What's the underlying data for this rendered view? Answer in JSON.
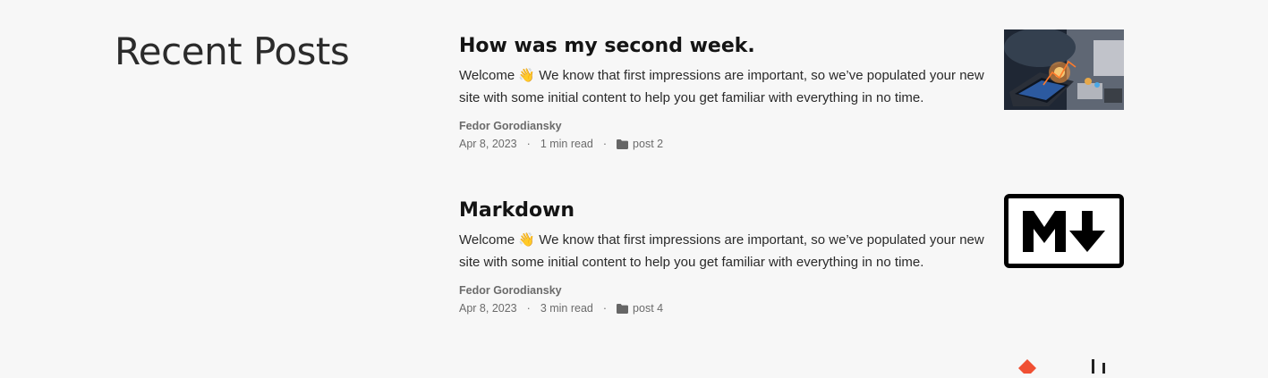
{
  "section": {
    "title": "Recent Posts"
  },
  "posts": [
    {
      "title": "How was my second week.",
      "excerpt": "Welcome 👋 We know that first impressions are important, so we’ve populated your new site with some initial content to help you get familiar with everything in no time.",
      "author": "Fedor Gorodiansky",
      "date": "Apr 8, 2023",
      "separator": "·",
      "read_time": "1 min read",
      "category": "post 2",
      "thumbnail_icon": "tablet-analytics-image"
    },
    {
      "title": "Markdown",
      "excerpt": "Welcome 👋 We know that first impressions are important, so we’ve populated your new site with some initial content to help you get familiar with everything in no time.",
      "author": "Fedor Gorodiansky",
      "date": "Apr 8, 2023",
      "separator": "·",
      "read_time": "3 min read",
      "category": "post 4",
      "thumbnail_icon": "markdown-logo-image"
    }
  ],
  "colors": {
    "background": "#f7f7f7",
    "title": "#141414",
    "meta": "#6b6b6b",
    "git_accent": "#f05033"
  }
}
